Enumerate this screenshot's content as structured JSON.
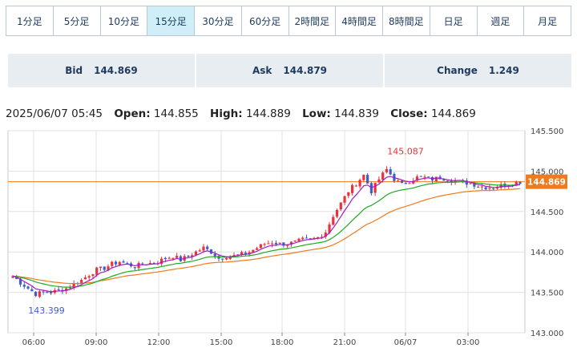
{
  "timeframe_tabs": [
    {
      "label": "1分足",
      "active": false
    },
    {
      "label": "5分足",
      "active": false
    },
    {
      "label": "10分足",
      "active": false
    },
    {
      "label": "15分足",
      "active": true
    },
    {
      "label": "30分足",
      "active": false
    },
    {
      "label": "60分足",
      "active": false
    },
    {
      "label": "2時間足",
      "active": false
    },
    {
      "label": "4時間足",
      "active": false
    },
    {
      "label": "8時間足",
      "active": false
    },
    {
      "label": "日足",
      "active": false
    },
    {
      "label": "週足",
      "active": false
    },
    {
      "label": "月足",
      "active": false
    }
  ],
  "quote": {
    "bid_label": "Bid",
    "bid_value": "144.869",
    "ask_label": "Ask",
    "ask_value": "144.879",
    "change_label": "Change",
    "change_value": "1.249"
  },
  "ohlc": {
    "datetime": "2025/06/07 05:45",
    "open_label": "Open:",
    "open": "144.855",
    "high_label": "High:",
    "high": "144.889",
    "low_label": "Low:",
    "low": "144.839",
    "close_label": "Close:",
    "close": "144.869"
  },
  "colors": {
    "up": "#e8323c",
    "down": "#3e5ec9",
    "ma_short": "#a020c0",
    "ma_mid": "#22aa22",
    "ma_long": "#f07a1e",
    "last_price": "#f07a1e",
    "grid": "#e0e0e0",
    "accent_tab": "#cfeef7"
  },
  "chart_data": {
    "type": "candlestick",
    "ylim": [
      143.0,
      145.5
    ],
    "y_ticks": [
      "145.500",
      "145.000",
      "144.500",
      "144.000",
      "143.500",
      "143.000"
    ],
    "x_ticks": [
      "06:00",
      "09:00",
      "12:00",
      "15:00",
      "18:00",
      "21:00",
      "06/07",
      "03:00"
    ],
    "last_price": 144.869,
    "last_price_label": "144.869",
    "high_annotation": {
      "value": 145.087,
      "label": "145.087"
    },
    "low_annotation": {
      "value": 143.399,
      "label": "143.399"
    },
    "close_path": [
      [
        0,
        143.7
      ],
      [
        2,
        143.62
      ],
      [
        4,
        143.55
      ],
      [
        6,
        143.48
      ],
      [
        8,
        143.5
      ],
      [
        10,
        143.5
      ],
      [
        12,
        143.52
      ],
      [
        14,
        143.55
      ],
      [
        16,
        143.6
      ],
      [
        18,
        143.65
      ],
      [
        20,
        143.72
      ],
      [
        22,
        143.78
      ],
      [
        24,
        143.8
      ],
      [
        26,
        143.85
      ],
      [
        28,
        143.88
      ],
      [
        30,
        143.85
      ],
      [
        32,
        143.82
      ],
      [
        34,
        143.85
      ],
      [
        36,
        143.86
      ],
      [
        38,
        143.88
      ],
      [
        40,
        143.92
      ],
      [
        42,
        143.95
      ],
      [
        44,
        143.9
      ],
      [
        46,
        143.95
      ],
      [
        48,
        144.0
      ],
      [
        50,
        144.05
      ],
      [
        52,
        144.0
      ],
      [
        54,
        143.92
      ],
      [
        56,
        143.95
      ],
      [
        58,
        143.95
      ],
      [
        60,
        143.97
      ],
      [
        62,
        144.0
      ],
      [
        64,
        144.05
      ],
      [
        66,
        144.1
      ],
      [
        68,
        144.12
      ],
      [
        70,
        144.1
      ],
      [
        72,
        144.1
      ],
      [
        74,
        144.12
      ],
      [
        76,
        144.15
      ],
      [
        78,
        144.15
      ],
      [
        80,
        144.18
      ],
      [
        82,
        144.25
      ],
      [
        84,
        144.45
      ],
      [
        86,
        144.6
      ],
      [
        88,
        144.75
      ],
      [
        90,
        144.85
      ],
      [
        92,
        144.95
      ],
      [
        94,
        144.75
      ],
      [
        96,
        144.9
      ],
      [
        98,
        145.02
      ],
      [
        100,
        144.9
      ],
      [
        102,
        144.83
      ],
      [
        104,
        144.88
      ],
      [
        106,
        144.92
      ],
      [
        108,
        144.92
      ],
      [
        110,
        144.9
      ],
      [
        112,
        144.92
      ],
      [
        114,
        144.9
      ],
      [
        116,
        144.88
      ],
      [
        118,
        144.86
      ],
      [
        120,
        144.85
      ],
      [
        122,
        144.82
      ],
      [
        124,
        144.8
      ],
      [
        126,
        144.8
      ],
      [
        128,
        144.82
      ],
      [
        130,
        144.84
      ],
      [
        132,
        144.86
      ],
      [
        133,
        144.869
      ]
    ]
  }
}
